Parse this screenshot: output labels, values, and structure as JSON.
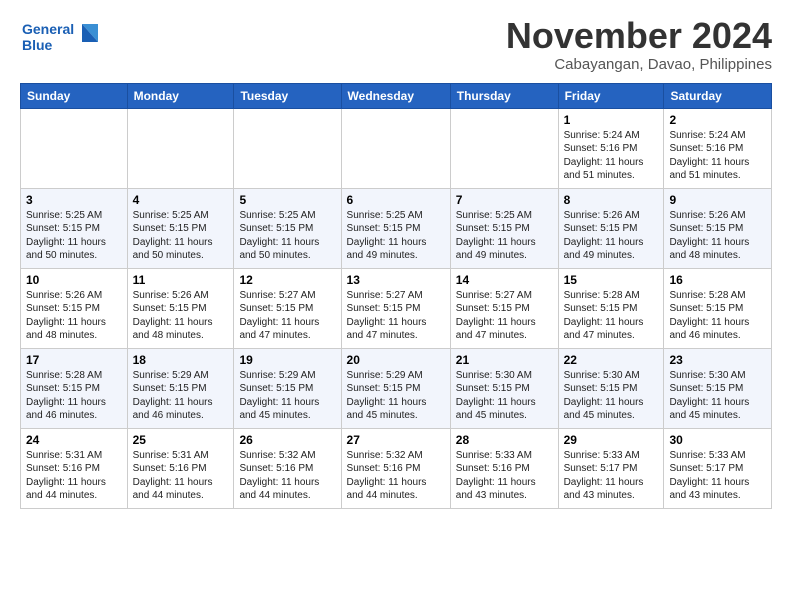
{
  "header": {
    "logo_line1": "General",
    "logo_line2": "Blue",
    "month_title": "November 2024",
    "location": "Cabayangan, Davao, Philippines"
  },
  "weekdays": [
    "Sunday",
    "Monday",
    "Tuesday",
    "Wednesday",
    "Thursday",
    "Friday",
    "Saturday"
  ],
  "weeks": [
    [
      {
        "day": "",
        "info": ""
      },
      {
        "day": "",
        "info": ""
      },
      {
        "day": "",
        "info": ""
      },
      {
        "day": "",
        "info": ""
      },
      {
        "day": "",
        "info": ""
      },
      {
        "day": "1",
        "info": "Sunrise: 5:24 AM\nSunset: 5:16 PM\nDaylight: 11 hours\nand 51 minutes."
      },
      {
        "day": "2",
        "info": "Sunrise: 5:24 AM\nSunset: 5:16 PM\nDaylight: 11 hours\nand 51 minutes."
      }
    ],
    [
      {
        "day": "3",
        "info": "Sunrise: 5:25 AM\nSunset: 5:15 PM\nDaylight: 11 hours\nand 50 minutes."
      },
      {
        "day": "4",
        "info": "Sunrise: 5:25 AM\nSunset: 5:15 PM\nDaylight: 11 hours\nand 50 minutes."
      },
      {
        "day": "5",
        "info": "Sunrise: 5:25 AM\nSunset: 5:15 PM\nDaylight: 11 hours\nand 50 minutes."
      },
      {
        "day": "6",
        "info": "Sunrise: 5:25 AM\nSunset: 5:15 PM\nDaylight: 11 hours\nand 49 minutes."
      },
      {
        "day": "7",
        "info": "Sunrise: 5:25 AM\nSunset: 5:15 PM\nDaylight: 11 hours\nand 49 minutes."
      },
      {
        "day": "8",
        "info": "Sunrise: 5:26 AM\nSunset: 5:15 PM\nDaylight: 11 hours\nand 49 minutes."
      },
      {
        "day": "9",
        "info": "Sunrise: 5:26 AM\nSunset: 5:15 PM\nDaylight: 11 hours\nand 48 minutes."
      }
    ],
    [
      {
        "day": "10",
        "info": "Sunrise: 5:26 AM\nSunset: 5:15 PM\nDaylight: 11 hours\nand 48 minutes."
      },
      {
        "day": "11",
        "info": "Sunrise: 5:26 AM\nSunset: 5:15 PM\nDaylight: 11 hours\nand 48 minutes."
      },
      {
        "day": "12",
        "info": "Sunrise: 5:27 AM\nSunset: 5:15 PM\nDaylight: 11 hours\nand 47 minutes."
      },
      {
        "day": "13",
        "info": "Sunrise: 5:27 AM\nSunset: 5:15 PM\nDaylight: 11 hours\nand 47 minutes."
      },
      {
        "day": "14",
        "info": "Sunrise: 5:27 AM\nSunset: 5:15 PM\nDaylight: 11 hours\nand 47 minutes."
      },
      {
        "day": "15",
        "info": "Sunrise: 5:28 AM\nSunset: 5:15 PM\nDaylight: 11 hours\nand 47 minutes."
      },
      {
        "day": "16",
        "info": "Sunrise: 5:28 AM\nSunset: 5:15 PM\nDaylight: 11 hours\nand 46 minutes."
      }
    ],
    [
      {
        "day": "17",
        "info": "Sunrise: 5:28 AM\nSunset: 5:15 PM\nDaylight: 11 hours\nand 46 minutes."
      },
      {
        "day": "18",
        "info": "Sunrise: 5:29 AM\nSunset: 5:15 PM\nDaylight: 11 hours\nand 46 minutes."
      },
      {
        "day": "19",
        "info": "Sunrise: 5:29 AM\nSunset: 5:15 PM\nDaylight: 11 hours\nand 45 minutes."
      },
      {
        "day": "20",
        "info": "Sunrise: 5:29 AM\nSunset: 5:15 PM\nDaylight: 11 hours\nand 45 minutes."
      },
      {
        "day": "21",
        "info": "Sunrise: 5:30 AM\nSunset: 5:15 PM\nDaylight: 11 hours\nand 45 minutes."
      },
      {
        "day": "22",
        "info": "Sunrise: 5:30 AM\nSunset: 5:15 PM\nDaylight: 11 hours\nand 45 minutes."
      },
      {
        "day": "23",
        "info": "Sunrise: 5:30 AM\nSunset: 5:15 PM\nDaylight: 11 hours\nand 45 minutes."
      }
    ],
    [
      {
        "day": "24",
        "info": "Sunrise: 5:31 AM\nSunset: 5:16 PM\nDaylight: 11 hours\nand 44 minutes."
      },
      {
        "day": "25",
        "info": "Sunrise: 5:31 AM\nSunset: 5:16 PM\nDaylight: 11 hours\nand 44 minutes."
      },
      {
        "day": "26",
        "info": "Sunrise: 5:32 AM\nSunset: 5:16 PM\nDaylight: 11 hours\nand 44 minutes."
      },
      {
        "day": "27",
        "info": "Sunrise: 5:32 AM\nSunset: 5:16 PM\nDaylight: 11 hours\nand 44 minutes."
      },
      {
        "day": "28",
        "info": "Sunrise: 5:33 AM\nSunset: 5:16 PM\nDaylight: 11 hours\nand 43 minutes."
      },
      {
        "day": "29",
        "info": "Sunrise: 5:33 AM\nSunset: 5:17 PM\nDaylight: 11 hours\nand 43 minutes."
      },
      {
        "day": "30",
        "info": "Sunrise: 5:33 AM\nSunset: 5:17 PM\nDaylight: 11 hours\nand 43 minutes."
      }
    ]
  ]
}
